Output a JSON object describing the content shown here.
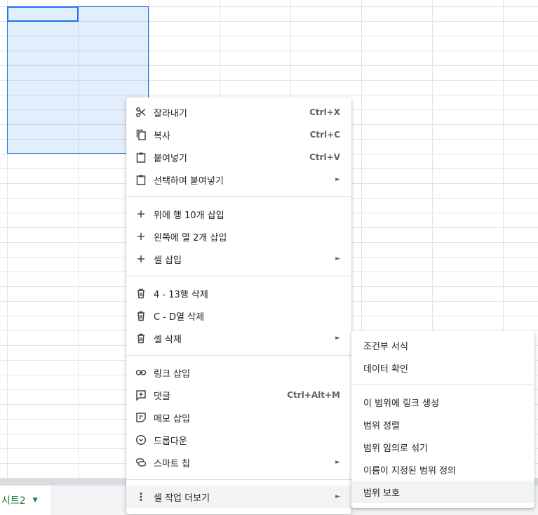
{
  "sheet_tab": {
    "label": "시트2"
  },
  "context_menu": {
    "groups": [
      [
        {
          "icon": "scissors-icon",
          "label": "잘라내기",
          "shortcut": "Ctrl+X"
        },
        {
          "icon": "copy-icon",
          "label": "복사",
          "shortcut": "Ctrl+C"
        },
        {
          "icon": "clipboard-icon",
          "label": "붙여넣기",
          "shortcut": "Ctrl+V"
        },
        {
          "icon": "clipboard-icon",
          "label": "선택하여 붙여넣기",
          "submenu": true
        }
      ],
      [
        {
          "icon": "plus-icon",
          "label": "위에 행 10개 삽입"
        },
        {
          "icon": "plus-icon",
          "label": "왼쪽에 열 2개 삽입"
        },
        {
          "icon": "plus-icon",
          "label": "셀 삽입",
          "submenu": true
        }
      ],
      [
        {
          "icon": "trash-icon",
          "label": "4 - 13행 삭제"
        },
        {
          "icon": "trash-icon",
          "label": "C - D열 삭제"
        },
        {
          "icon": "trash-icon",
          "label": "셀 삭제",
          "submenu": true
        }
      ],
      [
        {
          "icon": "link-icon",
          "label": "링크 삽입"
        },
        {
          "icon": "comment-add-icon",
          "label": "댓글",
          "shortcut": "Ctrl+Alt+M"
        },
        {
          "icon": "note-icon",
          "label": "메모 삽입"
        },
        {
          "icon": "dropdown-icon",
          "label": "드롭다운"
        },
        {
          "icon": "smart-chip-icon",
          "label": "스마트 칩",
          "submenu": true
        }
      ],
      [
        {
          "icon": "more-vert-icon",
          "label": "셀 작업 더보기",
          "submenu": true,
          "highlighted": true
        }
      ]
    ]
  },
  "sub_menu": {
    "groups": [
      [
        {
          "label": "조건부 서식"
        },
        {
          "label": "데이터 확인"
        }
      ],
      [
        {
          "label": "이 범위에 링크 생성"
        },
        {
          "label": "범위 정렬"
        },
        {
          "label": "범위 임의로 섞기"
        },
        {
          "label": "이름이 지정된 범위 정의"
        },
        {
          "label": "범위 보호",
          "highlighted": true
        }
      ]
    ]
  }
}
